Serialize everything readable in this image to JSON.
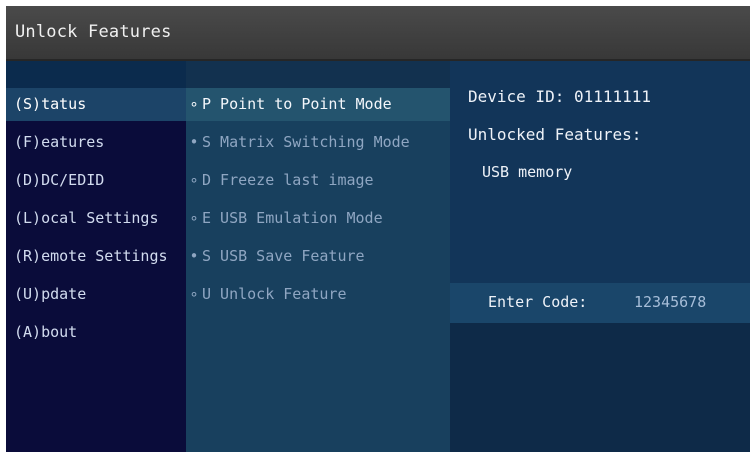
{
  "window": {
    "title": "Unlock Features"
  },
  "menu": {
    "items": [
      {
        "label": "(S)tatus",
        "selected": true
      },
      {
        "label": "(F)eatures",
        "selected": false
      },
      {
        "label": "(D)DC/EDID",
        "selected": false
      },
      {
        "label": "(L)ocal  Settings",
        "selected": false
      },
      {
        "label": "(R)emote Settings",
        "selected": false
      },
      {
        "label": "(U)pdate",
        "selected": false
      },
      {
        "label": "(A)bout",
        "selected": false
      }
    ]
  },
  "features": {
    "items": [
      {
        "bullet": "∘",
        "label": "P Point to Point Mode",
        "selected": true
      },
      {
        "bullet": "•",
        "label": "S Matrix Switching Mode",
        "selected": false
      },
      {
        "bullet": "∘",
        "label": "D Freeze last image",
        "selected": false
      },
      {
        "bullet": "∘",
        "label": "E USB Emulation Mode",
        "selected": false
      },
      {
        "bullet": "•",
        "label": "S USB Save Feature",
        "selected": false
      },
      {
        "bullet": "∘",
        "label": "U Unlock Feature",
        "selected": false
      }
    ]
  },
  "info": {
    "device_id": "Device ID: 01111111",
    "unlocked_label": "Unlocked Features:",
    "unlocked_list": [
      "USB memory"
    ]
  },
  "code": {
    "label": "Enter Code:",
    "value": "12345678"
  },
  "colors": {
    "titlebar": "#404040",
    "menu_bg": "#0a0c3a",
    "mid_bg": "#18405e",
    "selected_bg": "#1c4468",
    "text": "#d2dcef"
  }
}
